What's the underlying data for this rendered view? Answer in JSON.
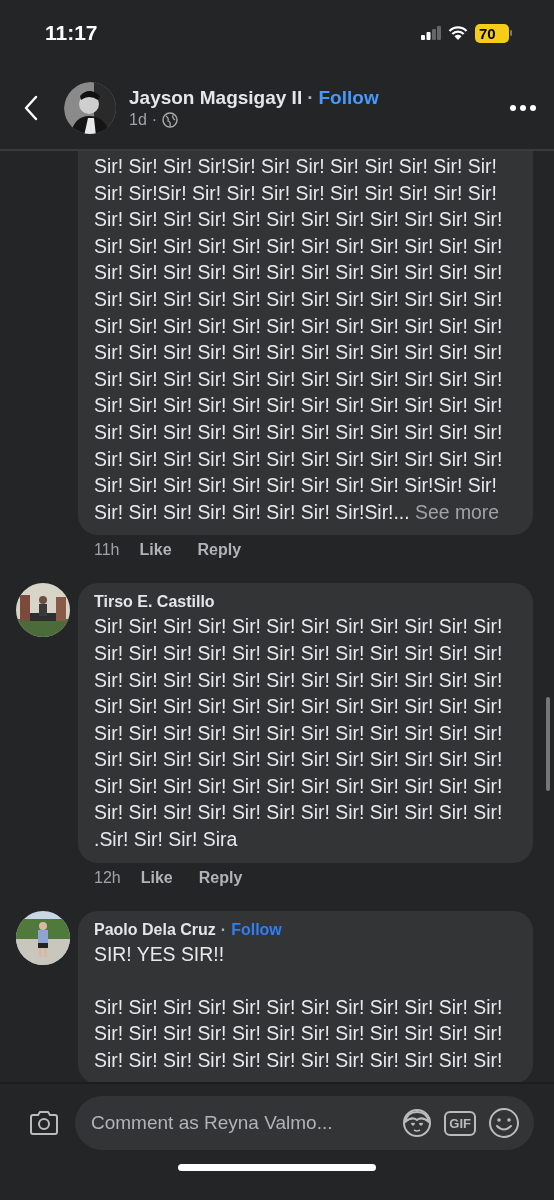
{
  "status_bar": {
    "time": "11:17",
    "battery": "70"
  },
  "post_header": {
    "author": "Jayson Magsigay II",
    "separator": "·",
    "follow": "Follow",
    "age": "1d",
    "age_separator": "·"
  },
  "comments": [
    {
      "kind": "continued",
      "text": "Sir! Sir! Sir! Sir!Sir! Sir! Sir! Sir! Sir! Sir! Sir! Sir!\nSir! Sir!Sir! Sir! Sir! Sir! Sir! Sir! Sir! Sir! Sir! Sir!\nSir! Sir! Sir! Sir! Sir! Sir! Sir! Sir! Sir! Sir! Sir! Sir!\nSir! Sir! Sir! Sir! Sir! Sir! Sir! Sir! Sir! Sir! Sir! Sir!\nSir! Sir! Sir! Sir! Sir! Sir! Sir! Sir! Sir! Sir! Sir! Sir!\nSir! Sir! Sir! Sir! Sir! Sir! Sir! Sir! Sir! Sir! Sir! Sir!\nSir! Sir! Sir! Sir! Sir! Sir! Sir! Sir! Sir! Sir! Sir! Sir!\nSir! Sir! Sir! Sir! Sir! Sir! Sir! Sir! Sir! Sir! Sir! Sir!\nSir! Sir! Sir! Sir! Sir! Sir! Sir! Sir! Sir! Sir! Sir! Sir!\nSir! Sir! Sir! Sir! Sir! Sir! Sir! Sir! Sir! Sir! Sir! Sir!\nSir! Sir! Sir! Sir! Sir! Sir! Sir! Sir! Sir! Sir! Sir! Sir!\nSir! Sir! Sir! Sir! Sir! Sir! Sir! Sir! Sir! Sir! Sir! Sir!\nSir! Sir! Sir! Sir! Sir! Sir! Sir! Sir! Sir! Sir!Sir! Sir!\nSir! Sir! Sir! Sir! Sir! Sir! Sir! Sir!Sir!...",
      "see_more": "See more",
      "time": "11h",
      "like": "Like",
      "reply": "Reply"
    },
    {
      "kind": "full",
      "author": "Tirso E. Castillo",
      "text": "Sir! Sir! Sir! Sir! Sir! Sir! Sir! Sir! Sir! Sir! Sir! Sir!\nSir! Sir! Sir! Sir! Sir! Sir! Sir! Sir! Sir! Sir! Sir! Sir!\nSir! Sir! Sir! Sir! Sir! Sir! Sir! Sir! Sir! Sir! Sir! Sir!\nSir! Sir! Sir! Sir! Sir! Sir! Sir! Sir! Sir! Sir! Sir! Sir!\nSir! Sir! Sir! Sir! Sir! Sir! Sir! Sir! Sir! Sir! Sir! Sir!\nSir! Sir! Sir! Sir! Sir! Sir! Sir! Sir! Sir! Sir! Sir! Sir!\nSir! Sir! Sir! Sir! Sir! Sir! Sir! Sir! Sir! Sir! Sir! Sir!\nSir! Sir! Sir! Sir! Sir! Sir! Sir! Sir! Sir! Sir! Sir! Sir!\n.Sir! Sir! Sir! Sira",
      "time": "12h",
      "like": "Like",
      "reply": "Reply"
    },
    {
      "kind": "full",
      "author": "Paolo Dela Cruz",
      "separator": "·",
      "follow": "Follow",
      "text": "SIR! YES SIR!!\n\nSir! Sir! Sir! Sir! Sir! Sir! Sir! Sir! Sir! Sir! Sir! Sir!\nSir! Sir! Sir! Sir! Sir! Sir! Sir! Sir! Sir! Sir! Sir! Sir!\nSir! Sir! Sir! Sir! Sir! Sir! Sir! Sir! Sir! Sir! Sir! Sir!"
    }
  ],
  "composer": {
    "placeholder": "Comment as Reyna Valmo...",
    "gif": "GIF"
  }
}
